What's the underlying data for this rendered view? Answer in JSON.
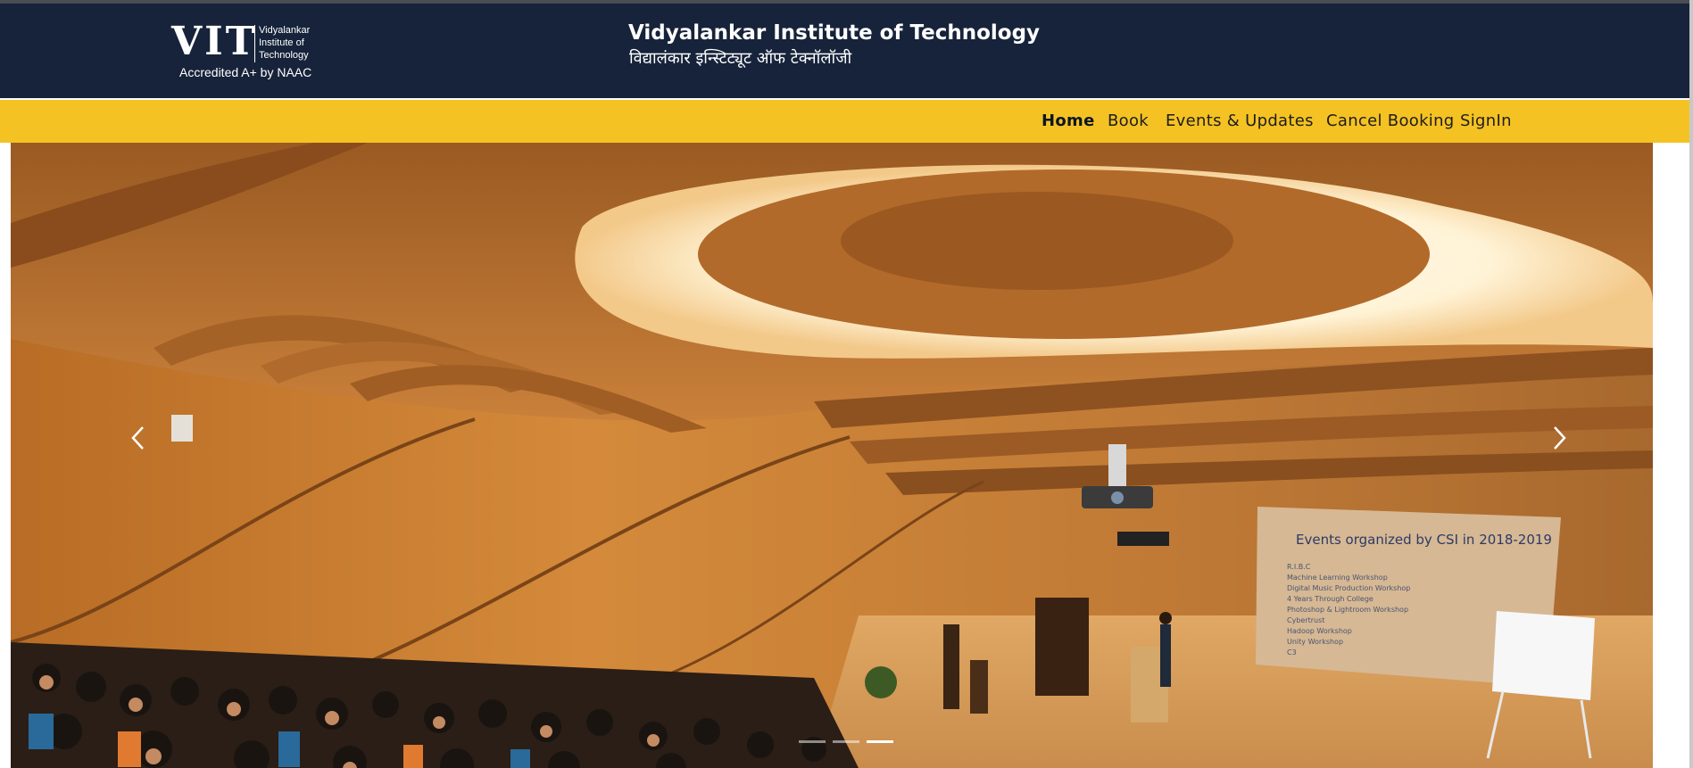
{
  "header": {
    "logo_mark": "VIT",
    "logo_lines": [
      "Vidyalankar",
      "Institute  of",
      "Technology"
    ],
    "accreditation": "Accredited A+ by NAAC",
    "institute_name": "Vidyalankar Institute of Technology",
    "institute_name_hindi": "विद्यालंकार इन्स्टिट्यूट ऑफ टेक्नॉलॉजी",
    "background_color": "#16233a"
  },
  "nav": {
    "background_color": "#f5c223",
    "items": [
      {
        "label": "Home",
        "active": true
      },
      {
        "label": "Book",
        "active": false
      },
      {
        "label": "Events & Updates",
        "active": false
      },
      {
        "label": "Cancel Booking",
        "active": false
      },
      {
        "label": "SignIn",
        "active": false
      }
    ]
  },
  "carousel": {
    "slide_count": 3,
    "active_slide": 3,
    "prev_icon": "chevron-left-icon",
    "next_icon": "chevron-right-icon",
    "slide_screen": {
      "title": "Events organized by CSI in 2018-2019",
      "items": [
        "R.I.B.C",
        "Machine Learning Workshop",
        "Digital Music Production Workshop",
        "4 Years Through College",
        "Photoshop & Lightroom Workshop",
        "Cybertrust",
        "Hadoop Workshop",
        "Unity Workshop",
        "C3"
      ]
    }
  }
}
